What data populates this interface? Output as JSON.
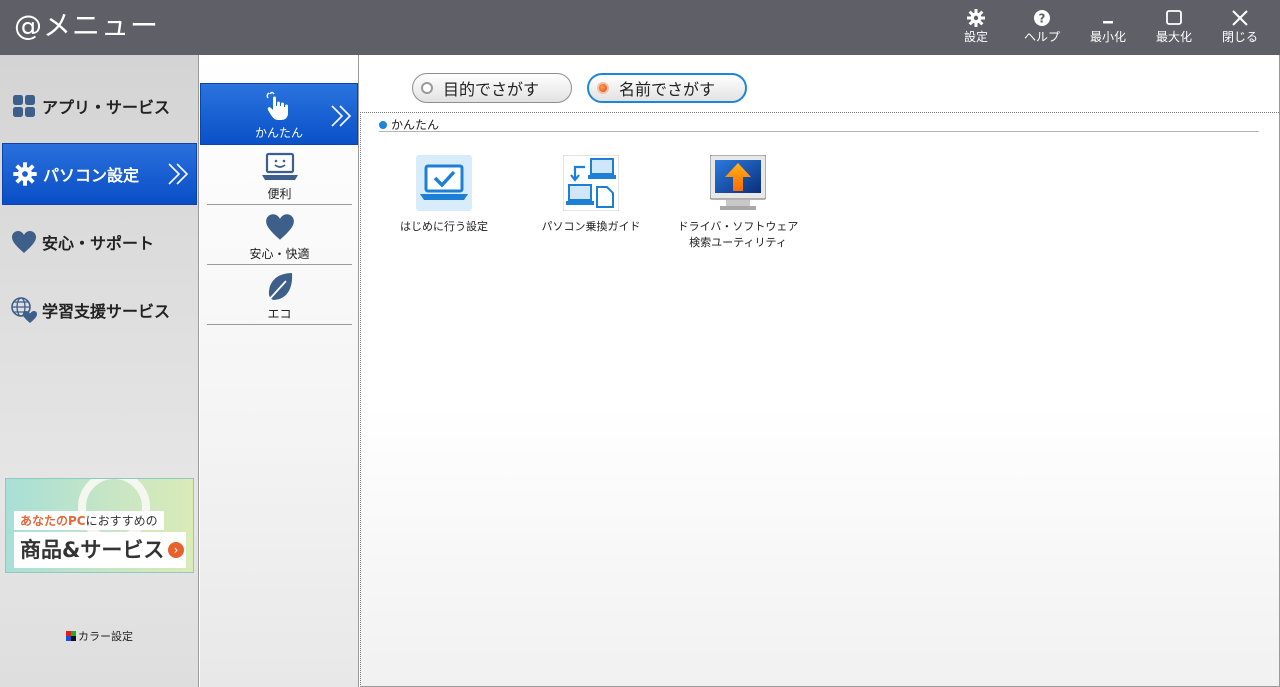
{
  "title": "@メニュー",
  "toolbar": {
    "settings": "設定",
    "help": "ヘルプ",
    "minimize": "最小化",
    "maximize": "最大化",
    "close": "閉じる"
  },
  "leftnav": {
    "items": [
      {
        "label": "アプリ・サービス",
        "icon": "apps-grid-icon"
      },
      {
        "label": "パソコン設定",
        "icon": "gear-icon",
        "active": true
      },
      {
        "label": "安心・サポート",
        "icon": "heart-icon"
      },
      {
        "label": "学習支援サービス",
        "icon": "globe-heart-icon"
      }
    ],
    "banner": {
      "line1_highlight": "あなたのPC",
      "line1_rest": "におすすめの",
      "line2": "商品&サービス"
    },
    "color_setting": "カラー設定"
  },
  "subnav": {
    "items": [
      {
        "label": "かんたん",
        "icon": "pointing-hand-icon",
        "active": true
      },
      {
        "label": "便利",
        "icon": "laptop-smile-icon"
      },
      {
        "label": "安心・快適",
        "icon": "heart-icon"
      },
      {
        "label": "エコ",
        "icon": "leaf-icon"
      }
    ]
  },
  "search": {
    "by_purpose": "目的でさがす",
    "by_name": "名前でさがす",
    "selected": "by_name"
  },
  "section": {
    "heading": "かんたん",
    "tools": [
      {
        "label": "はじめに行う設定",
        "icon": "laptop-check-icon"
      },
      {
        "label": "パソコン乗換ガイド",
        "icon": "pc-transfer-icon"
      },
      {
        "label_line1": "ドライバ・ソフトウェア",
        "label_line2": "検索ユーティリティ",
        "icon": "monitor-update-icon"
      }
    ]
  },
  "colors": {
    "titlebar": "#5f5f67",
    "active_blue": "#0a50c8",
    "nav_icon": "#3e5f8a",
    "radio_selected": "#e85a1e",
    "pill_border_selected": "#1e86d8"
  }
}
